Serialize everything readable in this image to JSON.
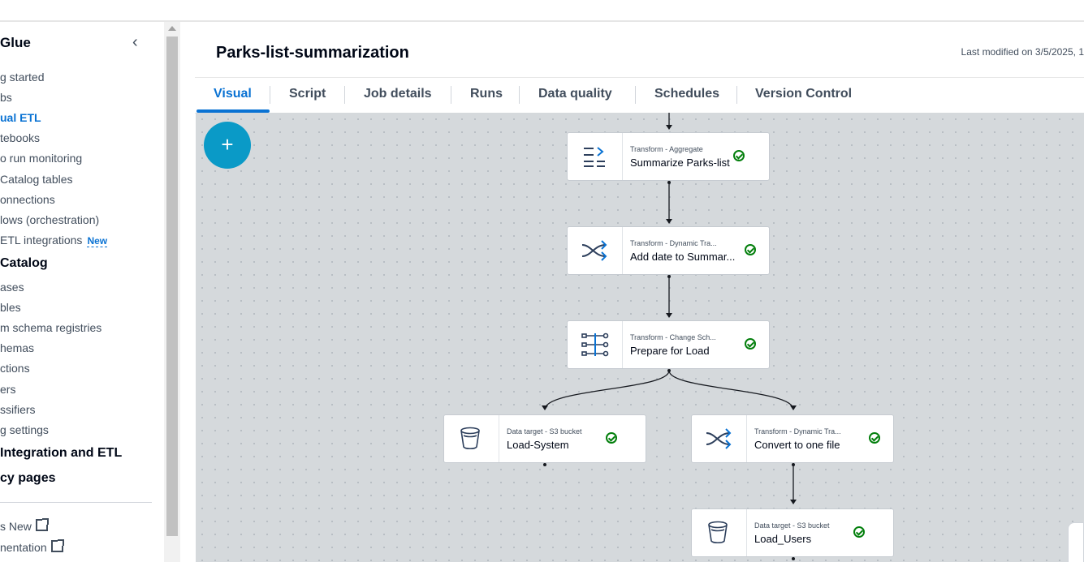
{
  "sidebar": {
    "header": "Glue",
    "items": [
      {
        "label": "g started"
      },
      {
        "label": "bs"
      },
      {
        "label": "ual ETL",
        "active": true
      },
      {
        "label": "tebooks"
      },
      {
        "label": "o run monitoring"
      },
      {
        "label": "Catalog tables"
      },
      {
        "label": "onnections"
      },
      {
        "label": "lows (orchestration)"
      },
      {
        "label": "ETL integrations",
        "badge": "New"
      }
    ],
    "section_catalog": "Catalog",
    "catalog_items": [
      {
        "label": "ases"
      },
      {
        "label": "bles"
      },
      {
        "label": "m schema registries"
      },
      {
        "label": "hemas"
      },
      {
        "label": "ctions"
      },
      {
        "label": "ers"
      },
      {
        "label": "ssifiers"
      },
      {
        "label": "g settings"
      }
    ],
    "section_integration": "Integration and ETL",
    "section_legacy": "cy pages",
    "footer_links": [
      {
        "label": "s New"
      },
      {
        "label": "nentation"
      }
    ]
  },
  "job": {
    "title": "Parks-list-summarization",
    "last_modified": "Last modified on 3/5/2025, 1"
  },
  "tabs": [
    {
      "label": "Visual",
      "active": true
    },
    {
      "label": "Script"
    },
    {
      "label": "Job details"
    },
    {
      "label": "Runs"
    },
    {
      "label": "Data quality"
    },
    {
      "label": "Schedules"
    },
    {
      "label": "Version Control"
    }
  ],
  "canvas": {
    "add_label": "+",
    "nodes": [
      {
        "type": "Transform - Aggregate",
        "name": "Summarize Parks-list",
        "icon": "aggregate-icon",
        "status": "success"
      },
      {
        "type": "Transform - Dynamic Tra...",
        "name": "Add date to Summar...",
        "icon": "shuffle-icon",
        "status": "success"
      },
      {
        "type": "Transform - Change Sch...",
        "name": "Prepare for Load",
        "icon": "schema-icon",
        "status": "success"
      },
      {
        "type": "Data target - S3 bucket",
        "name": "Load-System",
        "icon": "bucket-icon",
        "status": "success"
      },
      {
        "type": "Transform - Dynamic Tra...",
        "name": "Convert to one file",
        "icon": "shuffle-icon",
        "status": "success"
      },
      {
        "type": "Data target - S3 bucket",
        "name": "Load_Users",
        "icon": "bucket-icon",
        "status": "success"
      }
    ]
  },
  "colors": {
    "accent": "#0972d3",
    "add_button": "#0a9ac7",
    "success": "#037f0c",
    "canvas": "#d5d9dc"
  }
}
